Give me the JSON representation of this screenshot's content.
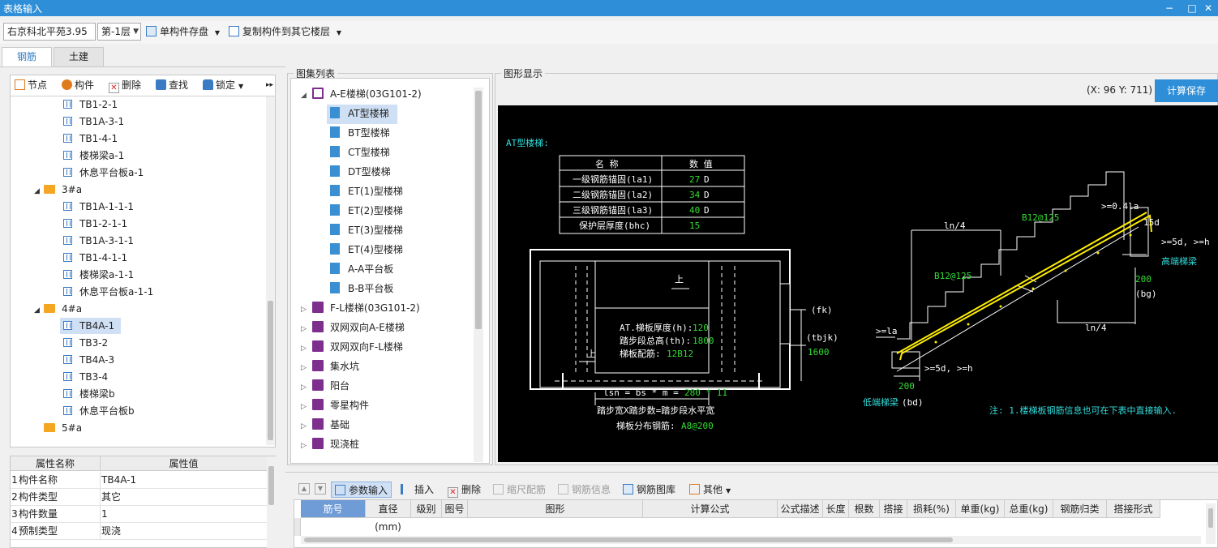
{
  "window": {
    "title": "表格输入",
    "minimize": "−",
    "maximize": "□",
    "close": "✕"
  },
  "toolbar": {
    "project_select": "右京科北平苑3.95",
    "floor_select": "第-1层",
    "save_single": "单构件存盘",
    "copy_to_floor": "复制构件到其它楼层"
  },
  "tabs": [
    {
      "label": "钢筋"
    },
    {
      "label": "土建"
    }
  ],
  "left_toolbar": {
    "node": "节点",
    "component": "构件",
    "delete": "删除",
    "find": "查找",
    "lock": "锁定"
  },
  "tree": [
    {
      "label": "TB1-2-1",
      "type": "item",
      "depth": 2
    },
    {
      "label": "TB1A-3-1",
      "type": "item",
      "depth": 2
    },
    {
      "label": "TB1-4-1",
      "type": "item",
      "depth": 2
    },
    {
      "label": "楼梯梁a-1",
      "type": "item",
      "depth": 2
    },
    {
      "label": "休息平台板a-1",
      "type": "item",
      "depth": 2
    },
    {
      "label": "3#a",
      "type": "folder",
      "depth": 1,
      "expanded": true
    },
    {
      "label": "TB1A-1-1-1",
      "type": "item",
      "depth": 2
    },
    {
      "label": "TB1-2-1-1",
      "type": "item",
      "depth": 2
    },
    {
      "label": "TB1A-3-1-1",
      "type": "item",
      "depth": 2
    },
    {
      "label": "TB1-4-1-1",
      "type": "item",
      "depth": 2
    },
    {
      "label": "楼梯梁a-1-1",
      "type": "item",
      "depth": 2
    },
    {
      "label": "休息平台板a-1-1",
      "type": "item",
      "depth": 2
    },
    {
      "label": "4#a",
      "type": "folder",
      "depth": 1,
      "expanded": true
    },
    {
      "label": "TB4A-1",
      "type": "item",
      "depth": 2,
      "selected": true
    },
    {
      "label": "TB3-2",
      "type": "item",
      "depth": 2
    },
    {
      "label": "TB4A-3",
      "type": "item",
      "depth": 2
    },
    {
      "label": "TB3-4",
      "type": "item",
      "depth": 2
    },
    {
      "label": "楼梯梁b",
      "type": "item",
      "depth": 2
    },
    {
      "label": "休息平台板b",
      "type": "item",
      "depth": 2
    },
    {
      "label": "5#a",
      "type": "folder",
      "depth": 1,
      "expanded": false
    }
  ],
  "props": {
    "header_name": "属性名称",
    "header_value": "属性值",
    "rows": [
      {
        "num": "1",
        "name": "构件名称",
        "value": "TB4A-1"
      },
      {
        "num": "2",
        "name": "构件类型",
        "value": "其它"
      },
      {
        "num": "3",
        "name": "构件数量",
        "value": "1"
      },
      {
        "num": "4",
        "name": "预制类型",
        "value": "现浇"
      }
    ]
  },
  "atlas": {
    "title": "图集列表",
    "items": [
      {
        "label": "A-E楼梯(03G101-2)",
        "kind": "book-open",
        "depth": 0,
        "expanded": true
      },
      {
        "label": "AT型楼梯",
        "kind": "page",
        "depth": 1,
        "selected": true
      },
      {
        "label": "BT型楼梯",
        "kind": "page",
        "depth": 1
      },
      {
        "label": "CT型楼梯",
        "kind": "page",
        "depth": 1
      },
      {
        "label": "DT型楼梯",
        "kind": "page",
        "depth": 1
      },
      {
        "label": "ET(1)型楼梯",
        "kind": "page",
        "depth": 1
      },
      {
        "label": "ET(2)型楼梯",
        "kind": "page",
        "depth": 1
      },
      {
        "label": "ET(3)型楼梯",
        "kind": "page",
        "depth": 1
      },
      {
        "label": "ET(4)型楼梯",
        "kind": "page",
        "depth": 1
      },
      {
        "label": "A-A平台板",
        "kind": "page",
        "depth": 1
      },
      {
        "label": "B-B平台板",
        "kind": "page",
        "depth": 1
      },
      {
        "label": "F-L楼梯(03G101-2)",
        "kind": "book",
        "depth": 0
      },
      {
        "label": "双网双向A-E楼梯",
        "kind": "book",
        "depth": 0
      },
      {
        "label": "双网双向F-L楼梯",
        "kind": "book",
        "depth": 0
      },
      {
        "label": "集水坑",
        "kind": "book",
        "depth": 0
      },
      {
        "label": "阳台",
        "kind": "book",
        "depth": 0
      },
      {
        "label": "零星构件",
        "kind": "book",
        "depth": 0
      },
      {
        "label": "基础",
        "kind": "book",
        "depth": 0
      },
      {
        "label": "现浇桩",
        "kind": "book",
        "depth": 0
      }
    ]
  },
  "graphic": {
    "title": "图形显示",
    "coords": "(X: 96 Y: 711)",
    "calc_save": "计算保存",
    "drawing": {
      "heading": "AT型楼梯:",
      "table_head_name": "名  称",
      "table_head_value": "数  值",
      "table_rows": [
        {
          "name": "一级钢筋锚固(la1)",
          "value": "27",
          "unit": "D"
        },
        {
          "name": "二级钢筋锚固(la2)",
          "value": "34",
          "unit": "D"
        },
        {
          "name": "三级钢筋锚固(la3)",
          "value": "40",
          "unit": "D"
        },
        {
          "name": "保护层厚度(bhc)",
          "value": "15",
          "unit": ""
        }
      ],
      "up_label": "上",
      "thickness_label": "AT.梯板厚度(h):",
      "thickness_value": "120",
      "height_label": "踏步段总高(th):",
      "height_value": "1800",
      "rebar_label": "梯板配筋:",
      "rebar_value": "12B12",
      "fk": "(fk)",
      "tbjk": "(tbjk)",
      "tbjk_value": "1600",
      "lsn_formula": "lsn = bs * m = ",
      "lsn_value": "280 * 11",
      "lsn_note": "踏步宽X踏步数=踏步段水平宽",
      "dist_label": "梯板分布钢筋:",
      "dist_value": "A8@200",
      "ln4_top": "ln/4",
      "ln4_bottom": "ln/4",
      "b_top": "B12@125",
      "b_mid": "B12@125",
      "anchor_top": ">=0.4la",
      "d15": "15d",
      "anchor_right": ">=5d, >=h",
      "high_beam": "高端梯梁",
      "dim_200_right": "200",
      "bg": "(bg)",
      "la_left": ">=la",
      "anchor_bottom": ">=5d, >=h",
      "dim_200_left": "200",
      "low_beam": "低端梯梁",
      "bd": "(bd)",
      "note": "注: 1.楼梯板钢筋信息也可在下表中直接输入."
    }
  },
  "bottom_toolbar": {
    "up": "上移",
    "down": "下移",
    "param_input": "参数输入",
    "insert": "插入",
    "delete": "删除",
    "scale_rebar": "缩尺配筋",
    "rebar_info": "钢筋信息",
    "rebar_lib": "钢筋图库",
    "other": "其他"
  },
  "grid_columns": [
    "筋号",
    "直径(mm)",
    "级别",
    "图号",
    "图形",
    "计算公式",
    "公式描述",
    "长度",
    "根数",
    "搭接",
    "损耗(%)",
    "单重(kg)",
    "总重(kg)",
    "钢筋归类",
    "搭接形式"
  ],
  "colors": {
    "title_bar": "#2e8fd8",
    "accent_button": "#2e8fd8",
    "selection": "#cfe0f5",
    "cad_green": "#33dd33",
    "cad_yellow": "#ffee00",
    "cad_cyan": "#33dddd"
  }
}
